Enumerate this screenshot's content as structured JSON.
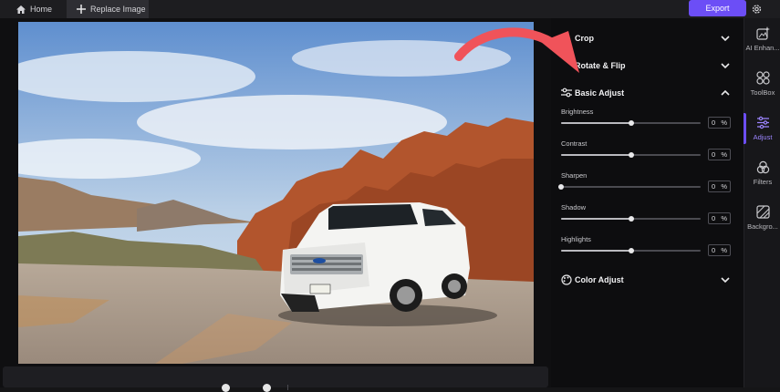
{
  "topbar": {
    "home_label": "Home",
    "replace_label": "Replace Image",
    "export_label": "Export"
  },
  "panel": {
    "sections": {
      "crop": "Crop",
      "rotate": "Rotate & Flip",
      "basic": "Basic Adjust",
      "color": "Color Adjust"
    },
    "sliders": [
      {
        "label": "Brightness",
        "value": "0",
        "unit": "%",
        "position": 0.5
      },
      {
        "label": "Contrast",
        "value": "0",
        "unit": "%",
        "position": 0.5
      },
      {
        "label": "Sharpen",
        "value": "0",
        "unit": "%",
        "position": 0.0
      },
      {
        "label": "Shadow",
        "value": "0",
        "unit": "%",
        "position": 0.5
      },
      {
        "label": "Highlights",
        "value": "0",
        "unit": "%",
        "position": 0.5
      }
    ]
  },
  "rail": {
    "items": [
      {
        "label": "AI Enhan...",
        "icon": "ai-enhance-icon"
      },
      {
        "label": "ToolBox",
        "icon": "toolbox-icon"
      },
      {
        "label": "Adjust",
        "icon": "adjust-icon",
        "active": true
      },
      {
        "label": "Filters",
        "icon": "filters-icon"
      },
      {
        "label": "Backgro...",
        "icon": "background-icon"
      }
    ]
  },
  "colors": {
    "accent": "#6c4ef6",
    "arrow": "#f0535a"
  }
}
